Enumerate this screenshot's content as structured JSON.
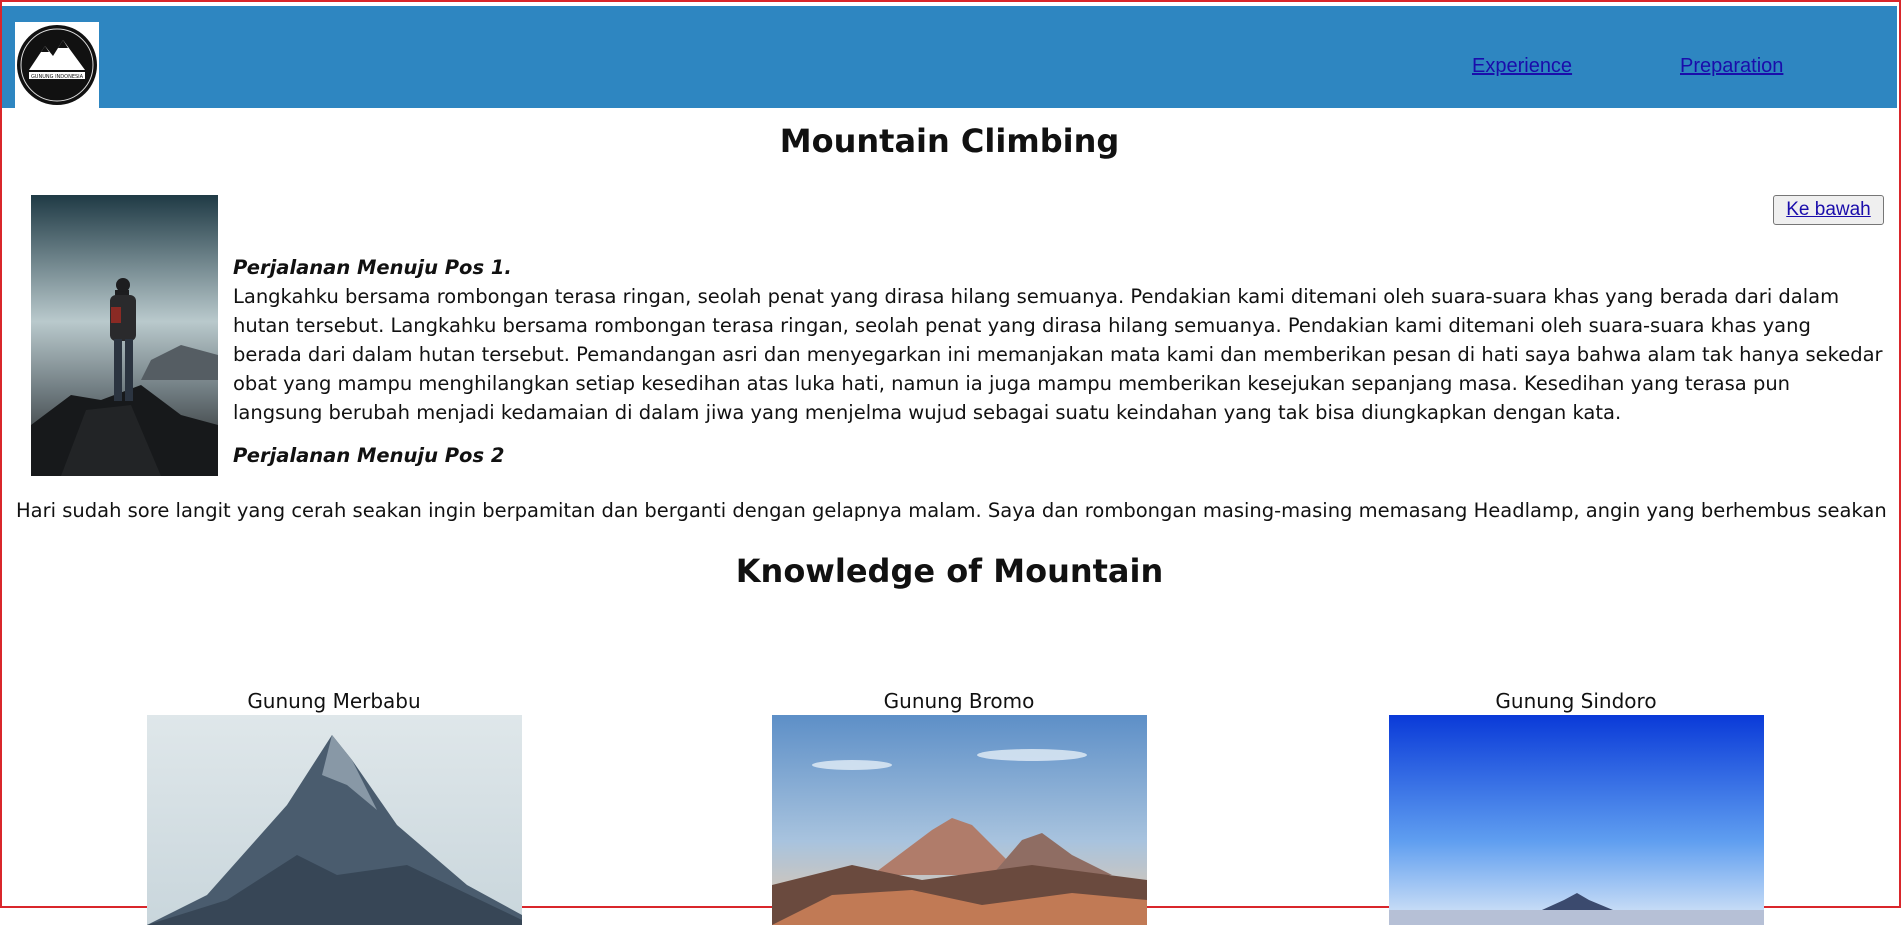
{
  "header": {
    "logo_text": "GUNUNG INDONESIA",
    "nav": [
      "Experience",
      "Preparation"
    ]
  },
  "main": {
    "title": "Mountain Climbing",
    "scroll_button": "Ke bawah",
    "section1_heading": "Perjalanan Menuju Pos 1.",
    "section1_text": "Langkahku bersama rombongan terasa ringan, seolah penat yang dirasa hilang semuanya. Pendakian kami ditemani oleh suara-suara khas yang berada dari dalam hutan tersebut. Langkahku bersama rombongan terasa ringan, seolah penat yang dirasa hilang semuanya. Pendakian kami ditemani oleh suara-suara khas yang berada dari dalam hutan tersebut. Pemandangan asri dan menyegarkan ini memanjakan mata kami dan memberikan pesan di hati saya bahwa alam tak hanya sekedar obat yang mampu menghilangkan setiap kesedihan atas luka hati, namun ia juga mampu memberikan kesejukan sepanjang masa. Kesedihan yang terasa pun langsung berubah menjadi kedamaian di dalam jiwa yang menjelma wujud sebagai suatu keindahan yang tak bisa diungkapkan dengan kata.",
    "section2_heading": "Perjalanan Menuju Pos 2",
    "section2_text": "Hari sudah sore langit yang cerah seakan ingin berpamitan dan berganti dengan gelapnya malam. Saya dan rombongan masing-masing memasang Headlamp, angin yang berhembus seakan"
  },
  "knowledge": {
    "title": "Knowledge of Mountain",
    "mountains": [
      "Gunung Merbabu",
      "Gunung Bromo",
      "Gunung Sindoro"
    ]
  }
}
